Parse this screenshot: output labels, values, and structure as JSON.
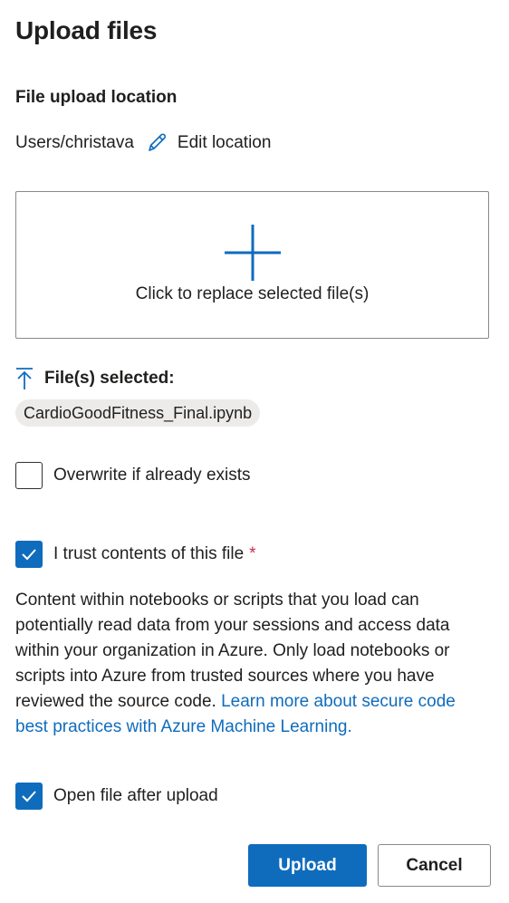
{
  "dialog": {
    "title": "Upload files"
  },
  "location": {
    "label": "File upload location",
    "path": "Users/christava",
    "edit_label": "Edit location"
  },
  "dropzone": {
    "text": "Click to replace selected file(s)"
  },
  "selected": {
    "label": "File(s) selected:",
    "files": [
      "CardioGoodFitness_Final.ipynb"
    ]
  },
  "options": {
    "overwrite": {
      "label": "Overwrite if already exists",
      "checked": false
    },
    "trust": {
      "label": "I trust contents of this file",
      "required_marker": "*",
      "checked": true
    },
    "open_after": {
      "label": "Open file after upload",
      "checked": true
    }
  },
  "notice": {
    "text": "Content within notebooks or scripts that you load can potentially read data from your sessions and access data within your organization in Azure. Only load notebooks or scripts into Azure from trusted sources where you have reviewed the source code.",
    "link_text": "Learn more about secure code best practices with Azure Machine Learning."
  },
  "buttons": {
    "upload": "Upload",
    "cancel": "Cancel"
  },
  "colors": {
    "accent": "#0f6cbd",
    "required": "#c4314b",
    "chip_bg": "#edebe9"
  },
  "icons": {
    "edit": "pencil-icon",
    "add": "plus-icon",
    "upload": "upload-arrow-icon",
    "check": "checkmark-icon"
  }
}
